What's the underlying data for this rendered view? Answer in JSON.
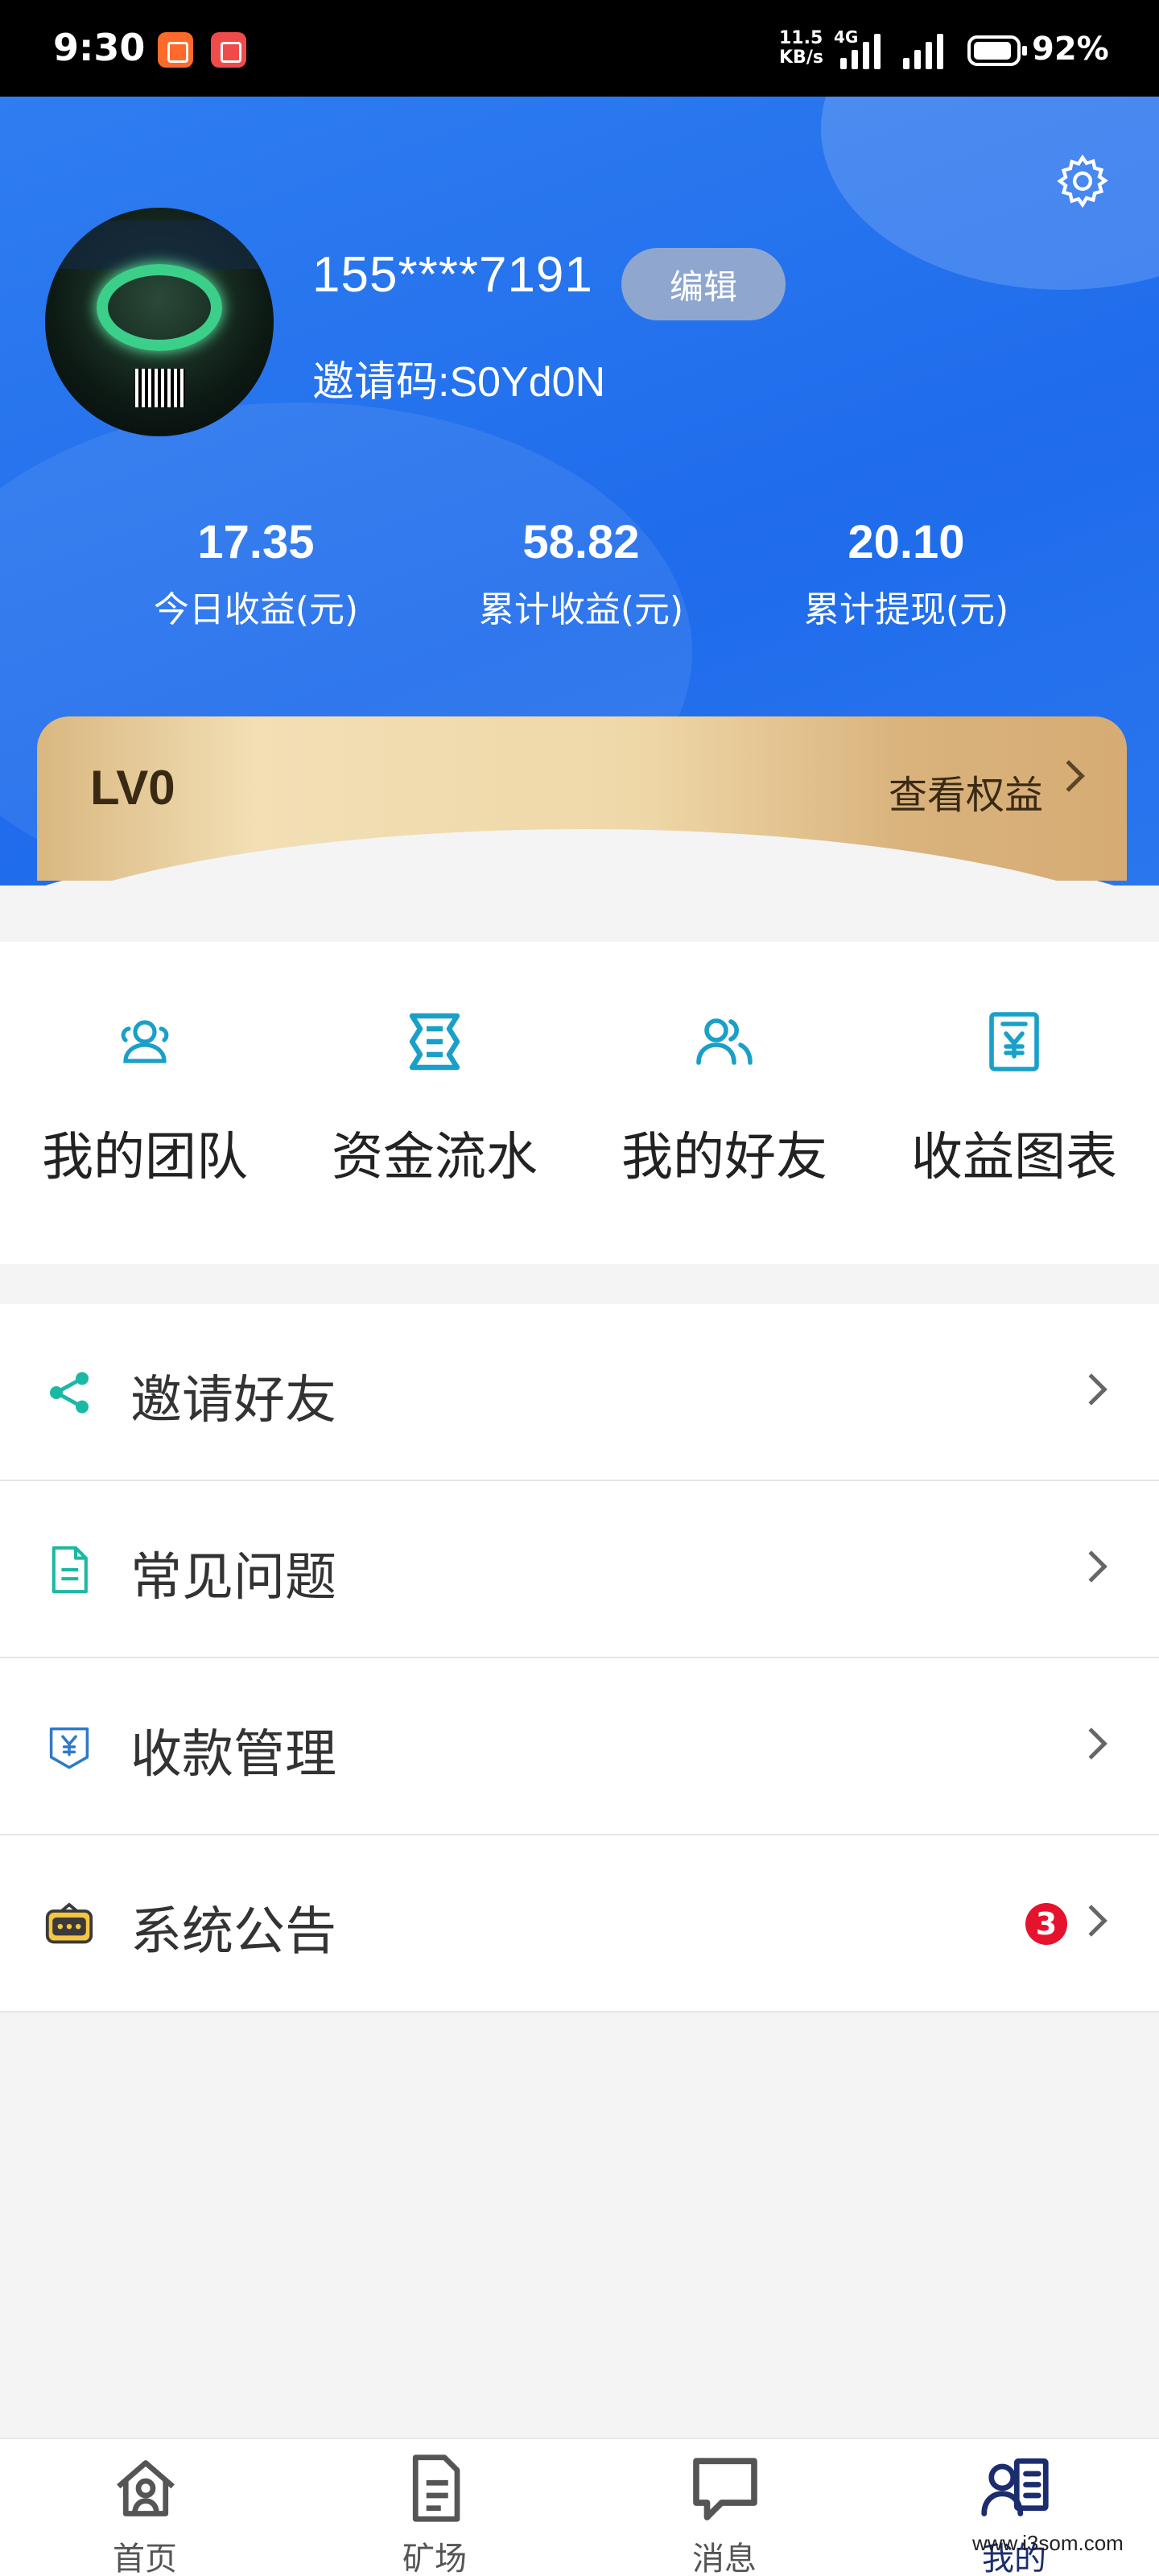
{
  "status_bar": {
    "time": "9:30",
    "net_speed": "11.5\nKB/s",
    "network": "4G",
    "battery": "92%"
  },
  "profile": {
    "phone": "155****7191",
    "edit_label": "编辑",
    "invite_code": "邀请码:S0Yd0N"
  },
  "stats": [
    {
      "value": "17.35",
      "label": "今日收益(元)"
    },
    {
      "value": "58.82",
      "label": "累计收益(元)"
    },
    {
      "value": "20.10",
      "label": "累计提现(元)"
    }
  ],
  "level": {
    "name": "LV0",
    "link": "查看权益"
  },
  "quick_actions": [
    {
      "label": "我的团队",
      "icon": "team-icon"
    },
    {
      "label": "资金流水",
      "icon": "ledger-icon"
    },
    {
      "label": "我的好友",
      "icon": "friends-icon"
    },
    {
      "label": "收益图表",
      "icon": "yuan-receipt-icon"
    }
  ],
  "menu": [
    {
      "label": "邀请好友",
      "icon": "share-icon"
    },
    {
      "label": "常见问题",
      "icon": "document-icon"
    },
    {
      "label": "收款管理",
      "icon": "yuan-tag-icon"
    },
    {
      "label": "系统公告",
      "icon": "announcement-icon",
      "badge": "3"
    }
  ],
  "tabs": [
    {
      "label": "首页",
      "icon": "home-icon"
    },
    {
      "label": "矿场",
      "icon": "file-icon"
    },
    {
      "label": "消息",
      "icon": "chat-icon"
    },
    {
      "label": "我的",
      "icon": "profile-icon",
      "active": true
    }
  ],
  "watermark": "www.i3som.com",
  "colors": {
    "header_blue": "#1f6cec",
    "accent_teal": "#1aa0c8",
    "badge_red": "#e5132d",
    "gold": "#e6c892"
  }
}
